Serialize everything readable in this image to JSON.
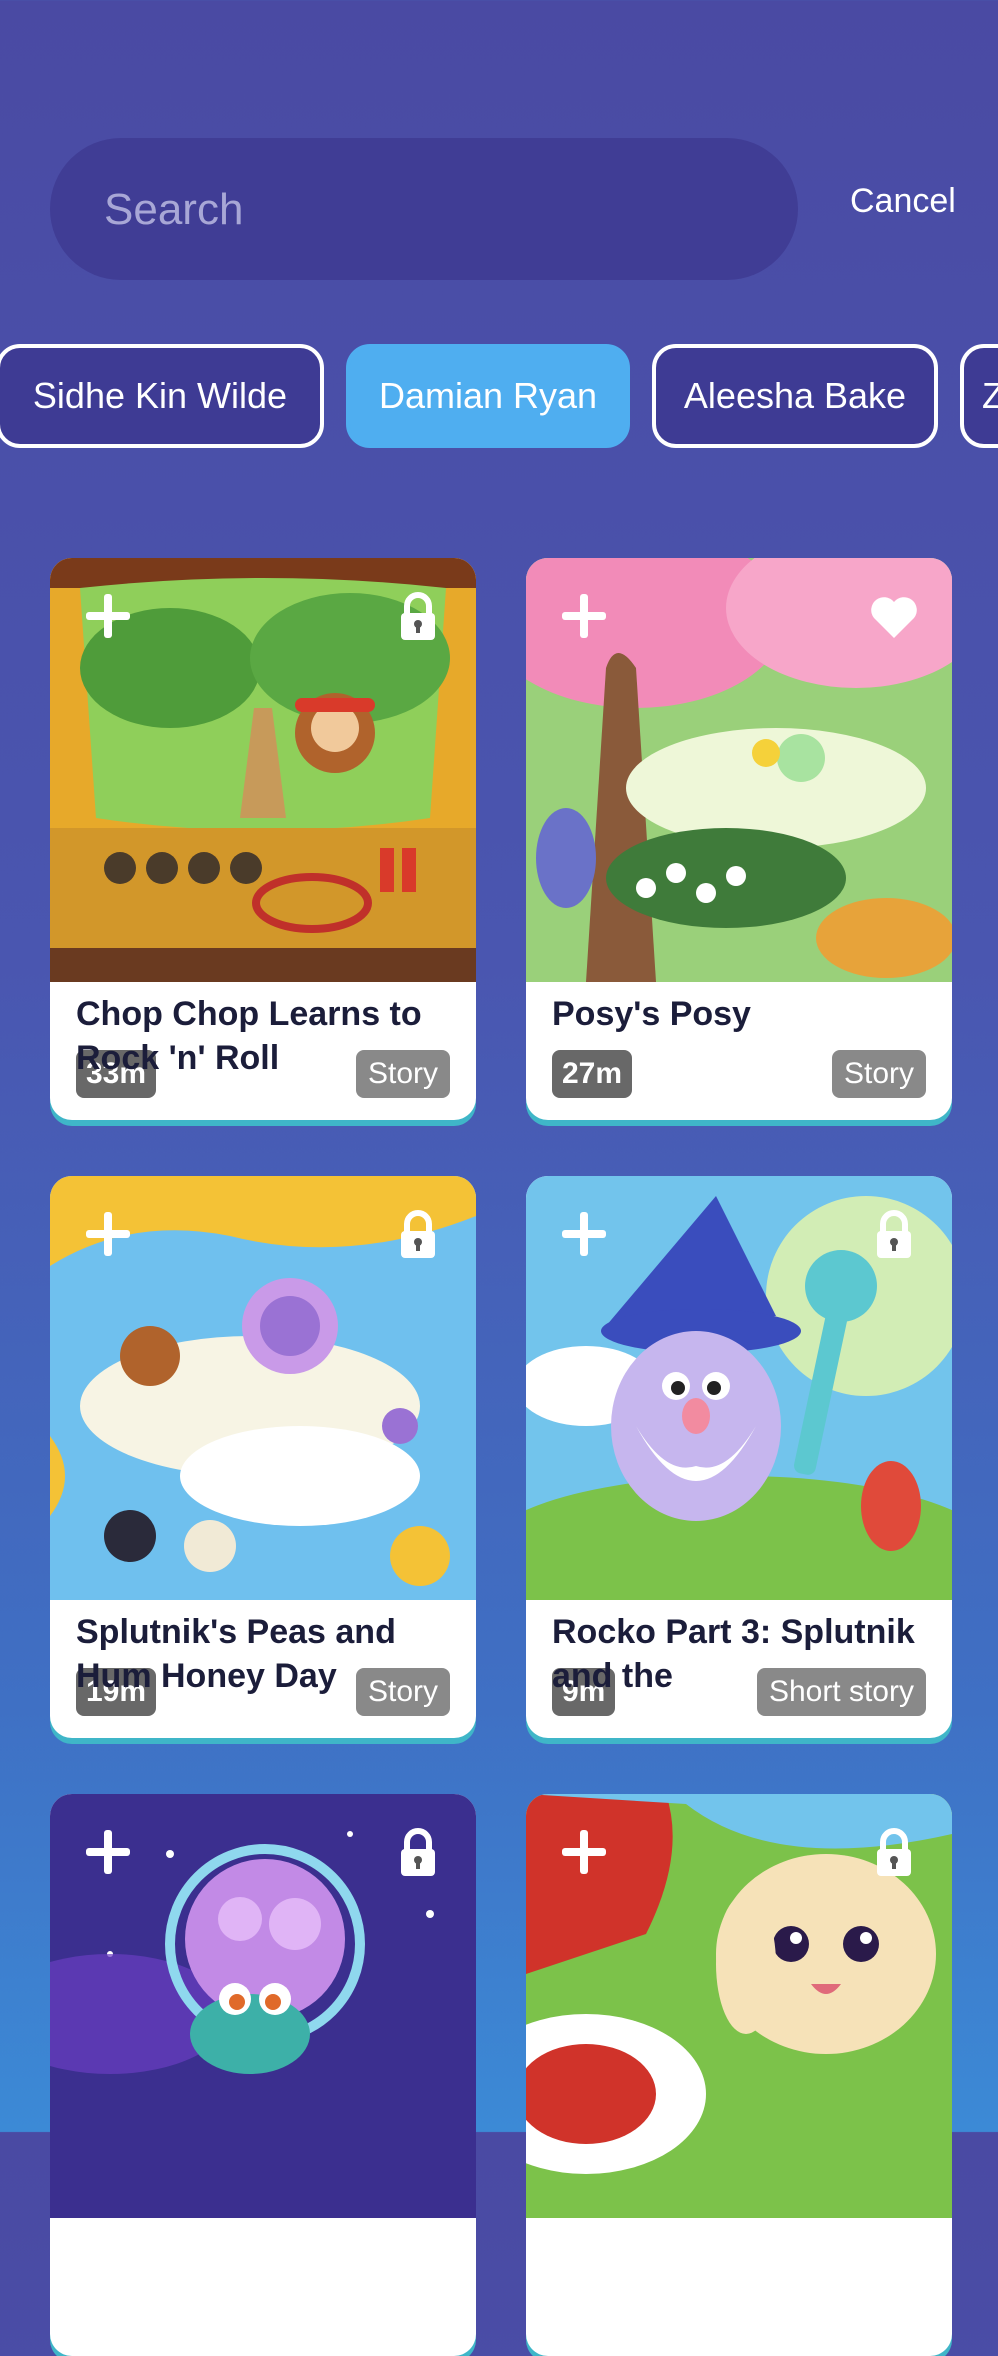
{
  "search": {
    "placeholder": "Search",
    "cancel_label": "Cancel"
  },
  "chips": [
    {
      "label": "Sidhe Kin Wilde",
      "selected": false
    },
    {
      "label": "Damian Ryan",
      "selected": true
    },
    {
      "label": "Aleesha Bake",
      "selected": false
    },
    {
      "label": "Z",
      "selected": false
    }
  ],
  "colors": {
    "accent": "#4faef0",
    "background_top": "#4a4aa3",
    "background_bottom": "#3c8ad6",
    "search_bg": "#403d95"
  },
  "cards": [
    {
      "title": "Chop Chop Learns to Rock 'n' Roll",
      "duration": "33m",
      "type": "Story",
      "corner_icon": "lock-icon"
    },
    {
      "title": "Posy's Posy",
      "duration": "27m",
      "type": "Story",
      "corner_icon": "heart-icon"
    },
    {
      "title": "Splutnik's Peas and Hum Honey Day",
      "duration": "19m",
      "type": "Story",
      "corner_icon": "lock-icon"
    },
    {
      "title": "Rocko Part 3: Splutnik and the",
      "duration": "9m",
      "type": "Short story",
      "corner_icon": "lock-icon"
    },
    {
      "title": "",
      "duration": "",
      "type": "",
      "corner_icon": "lock-icon"
    },
    {
      "title": "",
      "duration": "",
      "type": "",
      "corner_icon": "lock-icon"
    }
  ]
}
